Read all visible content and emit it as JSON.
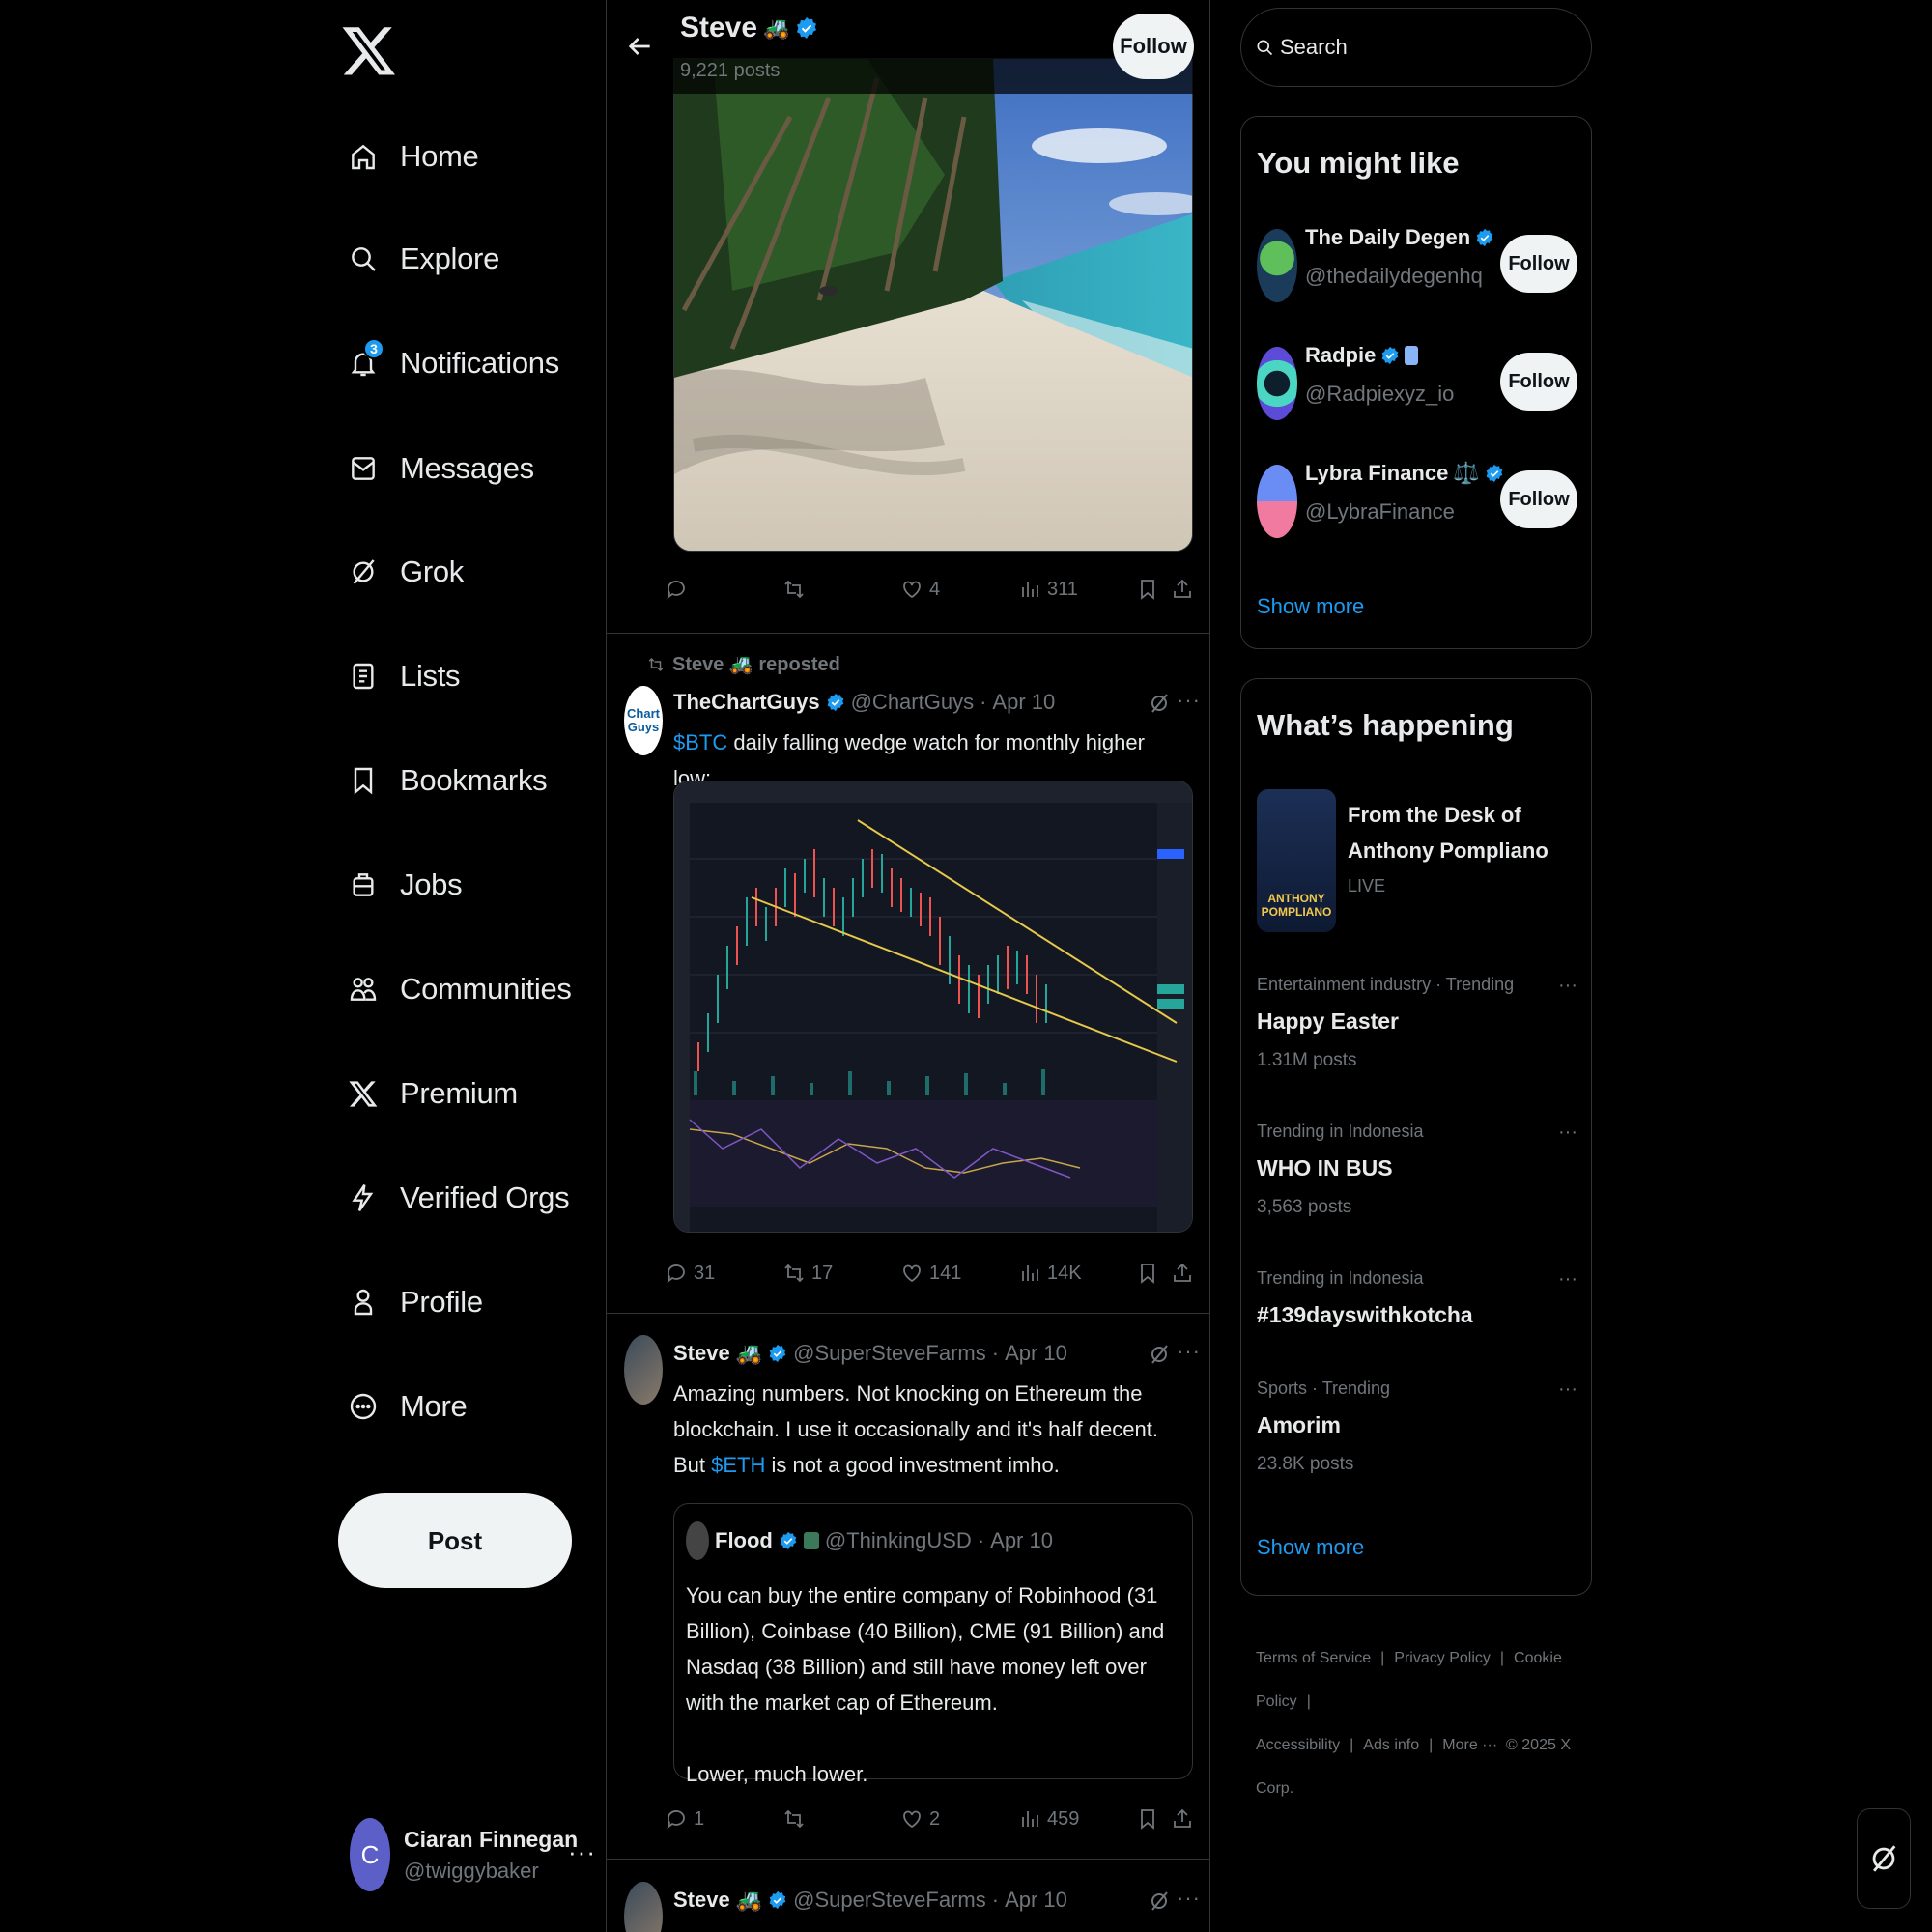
{
  "colors": {
    "accent": "#1d9bf0",
    "background": "#000000",
    "text": "#e7e9ea",
    "muted": "#71767b",
    "border": "#2f3336"
  },
  "nav": {
    "items": [
      {
        "label": "Home",
        "icon": "home-icon"
      },
      {
        "label": "Explore",
        "icon": "search-icon"
      },
      {
        "label": "Notifications",
        "icon": "bell-icon",
        "badge": "3"
      },
      {
        "label": "Messages",
        "icon": "envelope-icon"
      },
      {
        "label": "Grok",
        "icon": "grok-icon"
      },
      {
        "label": "Lists",
        "icon": "list-icon"
      },
      {
        "label": "Bookmarks",
        "icon": "bookmark-icon"
      },
      {
        "label": "Jobs",
        "icon": "briefcase-icon"
      },
      {
        "label": "Communities",
        "icon": "people-icon"
      },
      {
        "label": "Premium",
        "icon": "x-icon"
      },
      {
        "label": "Verified Orgs",
        "icon": "lightning-icon"
      },
      {
        "label": "Profile",
        "icon": "person-icon"
      },
      {
        "label": "More",
        "icon": "more-circle-icon"
      }
    ],
    "post_button": "Post",
    "account": {
      "initial": "C",
      "name": "Ciaran Finnegan",
      "handle": "@twiggybaker",
      "more": "···"
    }
  },
  "profile_header": {
    "name": "Steve",
    "name_emoji": "🚜",
    "posts": "9,221 posts",
    "follow_label": "Follow"
  },
  "tweets": [
    {
      "type": "image",
      "image": "beach-photo",
      "actions": {
        "replies": "",
        "reposts": "",
        "likes": "4",
        "views": "311"
      }
    },
    {
      "repost_by": "Steve 🚜 reposted",
      "author": "TheChartGuys",
      "handle": "@ChartGuys",
      "time": "Apr 10",
      "avatar_text": [
        "Chart",
        "Guys"
      ],
      "text_link": "$BTC",
      "text": " daily falling wedge watch for monthly higher low:",
      "image": "btc-chart",
      "actions": {
        "replies": "31",
        "reposts": "17",
        "likes": "141",
        "views": "14K"
      }
    },
    {
      "author": "Steve",
      "author_emoji": "🚜",
      "handle": "@SuperSteveFarms",
      "time": "Apr 10",
      "text_line1": "Amazing numbers. Not knocking on Ethereum the blockchain. I use it occasionally and it's half decent.",
      "text_but": "But ",
      "text_link": "$ETH",
      "text_end": " is not a good investment imho.",
      "quote": {
        "author": "Flood",
        "handle": "@ThinkingUSD",
        "time": "Apr 10",
        "text1": "You can buy the entire company of Robinhood (31 Billion), Coinbase (40 Billion), CME (91 Billion) and Nasdaq (38 Billion) and still have money left over with the market cap of Ethereum.",
        "text2": "Lower, much lower."
      },
      "actions": {
        "replies": "1",
        "reposts": "",
        "likes": "2",
        "views": "459"
      }
    },
    {
      "author": "Steve",
      "author_emoji": "🚜",
      "handle": "@SuperSteveFarms",
      "time": "Apr 10"
    }
  ],
  "sidebar": {
    "search_placeholder": "Search",
    "you_might_like": {
      "title": "You might like",
      "accounts": [
        {
          "name": "The Daily Degen",
          "handle": "@thedailydegenhq",
          "follow": "Follow"
        },
        {
          "name": "Radpie",
          "handle": "@Radpiexyz_io",
          "follow": "Follow"
        },
        {
          "name": "Lybra Finance",
          "name_emoji": "⚖️",
          "handle": "@LybraFinance",
          "follow": "Follow"
        }
      ],
      "show_more": "Show more"
    },
    "whats_happening": {
      "title": "What’s happening",
      "live": {
        "title": "From the Desk of Anthony Pompliano",
        "status": "LIVE",
        "thumb_text": [
          "ANTHONY",
          "POMPLIANO"
        ]
      },
      "trends": [
        {
          "context": "Entertainment industry · Trending",
          "topic": "Happy Easter",
          "posts": "1.31M posts"
        },
        {
          "context": "Trending in Indonesia",
          "topic": "WHO IN BUS",
          "posts": "3,563 posts"
        },
        {
          "context": "Trending in Indonesia",
          "topic": "#139dayswithkotcha",
          "posts": ""
        },
        {
          "context": "Sports · Trending",
          "topic": "Amorim",
          "posts": "23.8K posts"
        }
      ],
      "show_more": "Show more"
    },
    "footer": [
      "Terms of Service",
      "Privacy Policy",
      "Cookie Policy",
      "Accessibility",
      "Ads info",
      "More ···",
      "© 2025 X Corp."
    ]
  }
}
